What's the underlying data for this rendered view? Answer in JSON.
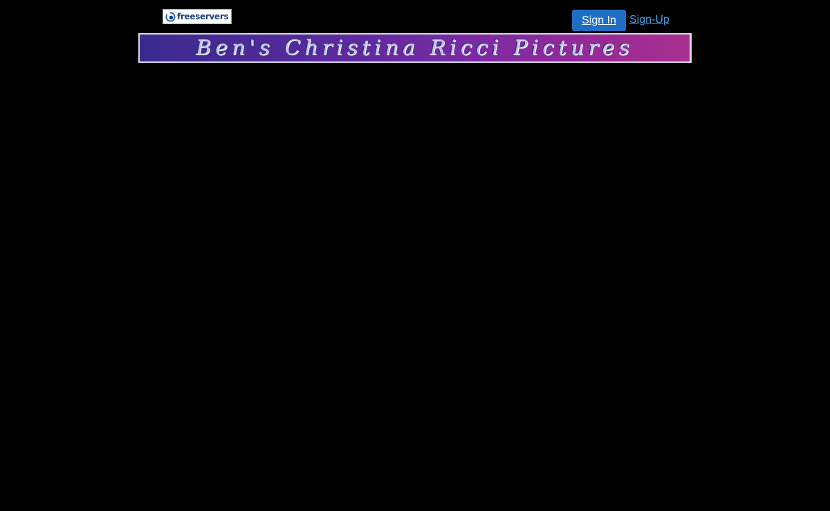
{
  "header": {
    "logo_text": "freeservers",
    "signin_label": "Sign In",
    "signup_label": "Sign-Up"
  },
  "banner": {
    "title": "Ben's Christina Ricci Pictures"
  },
  "colors": {
    "background": "#000000",
    "signin_button": "#1e6fc4",
    "signup_link": "#4aa0e6",
    "logo_text": "#1f3f7a"
  }
}
